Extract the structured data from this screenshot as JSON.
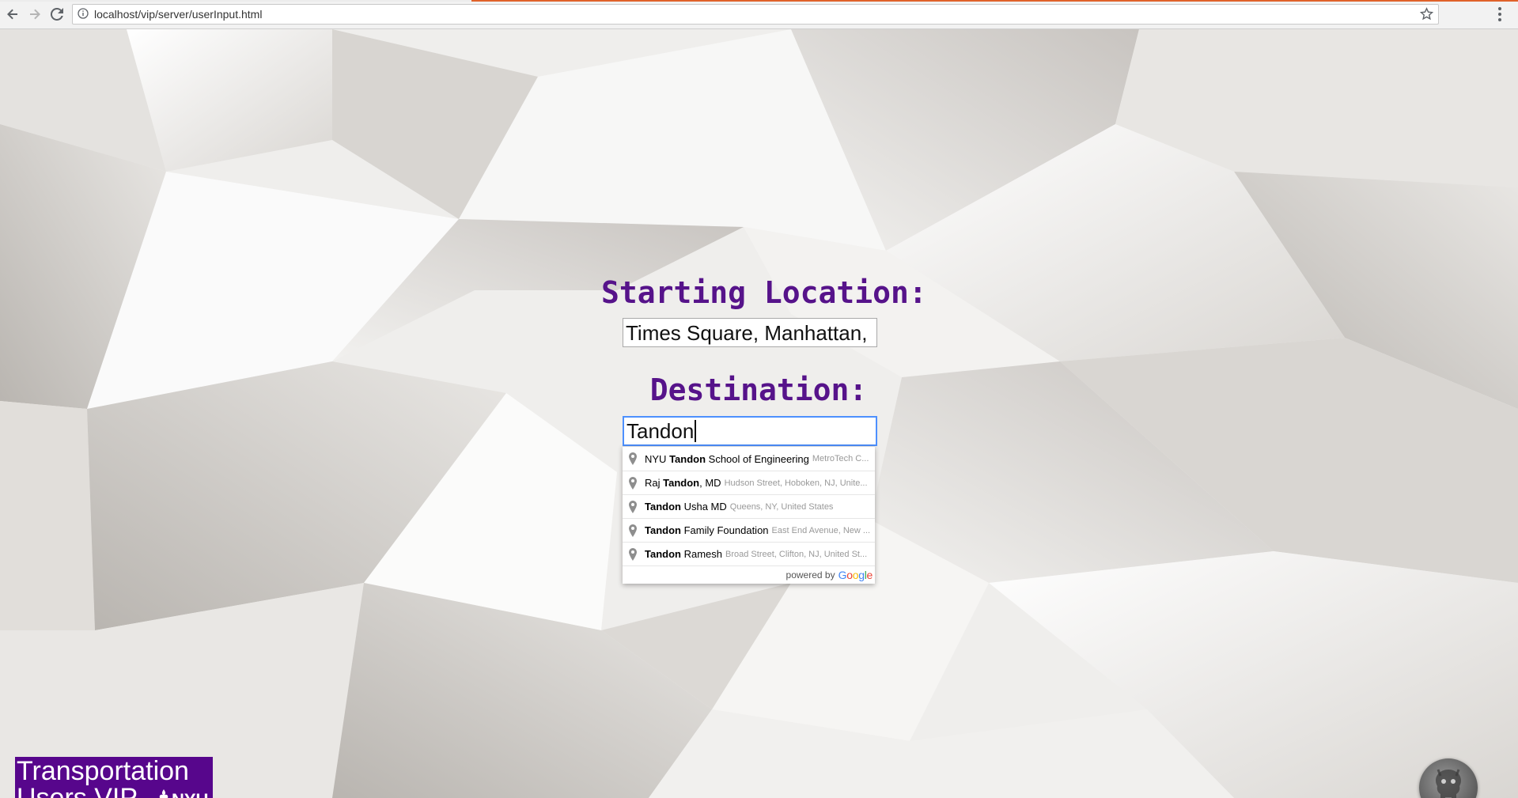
{
  "browser": {
    "url": "localhost/vip/server/userInput.html",
    "icons": [
      "back-icon",
      "forward-icon",
      "reload-icon",
      "info-icon",
      "star-icon",
      "menu-dots-icon"
    ]
  },
  "form": {
    "start_label": "Starting Location:",
    "start_value": "Times Square, Manhattan,",
    "dest_label": "Destination:",
    "dest_value": "Tandon"
  },
  "suggestions": [
    {
      "pre": "NYU ",
      "match": "Tandon",
      "post": " School of Engineering",
      "secondary": "MetroTech C..."
    },
    {
      "pre": "Raj ",
      "match": "Tandon",
      "post": ", MD",
      "secondary": "Hudson Street, Hoboken, NJ, Unite..."
    },
    {
      "pre": "",
      "match": "Tandon",
      "post": " Usha MD",
      "secondary": "Queens, NY, United States"
    },
    {
      "pre": "",
      "match": "Tandon",
      "post": " Family Foundation",
      "secondary": "East End Avenue, New ..."
    },
    {
      "pre": "",
      "match": "Tandon",
      "post": " Ramesh",
      "secondary": "Broad Street, Clifton, NJ, United St..."
    }
  ],
  "powered_by": {
    "text": "powered by",
    "logo_letters": [
      "G",
      "o",
      "o",
      "g",
      "l",
      "e"
    ],
    "logo_colors": [
      "#4285f4",
      "#ea4335",
      "#fbbc05",
      "#4285f4",
      "#34a853",
      "#ea4335"
    ]
  },
  "logo": {
    "line1": "Transportation",
    "line2": "Users VIP",
    "org": "NYU",
    "color": "#57068c"
  },
  "colors": {
    "label": "#56138a",
    "focus_border": "#4d90fe",
    "chrome_accent": "#e0622a"
  }
}
